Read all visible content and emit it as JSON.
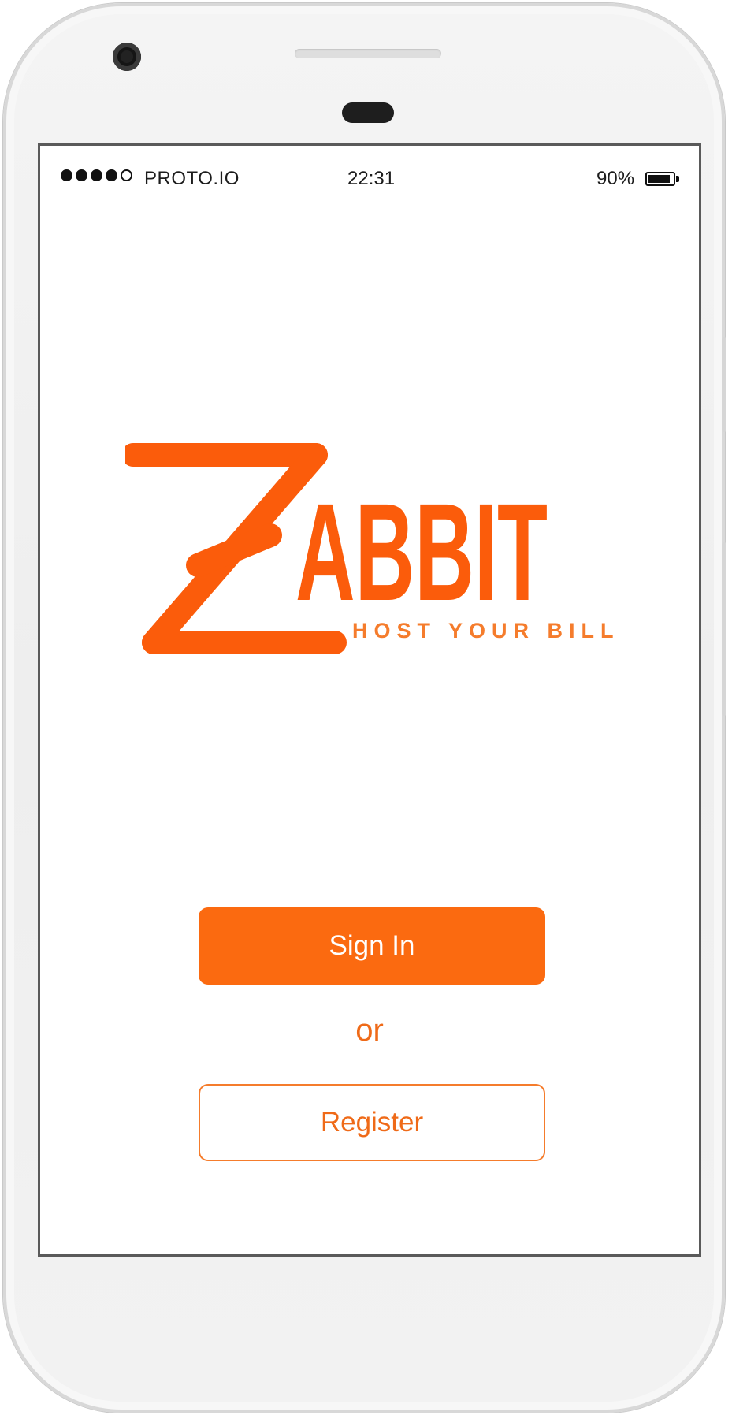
{
  "status_bar": {
    "carrier": "PROTO.IO",
    "time": "22:31",
    "battery": "90%",
    "signal_bars_filled": 4,
    "signal_bars_total": 5,
    "battery_level": 0.9
  },
  "logo": {
    "wordmark": "ZABBIT",
    "tagline": "HOST YOUR BILL",
    "color": "#fb5c0b"
  },
  "auth": {
    "sign_in_label": "Sign In",
    "separator": "or",
    "register_label": "Register"
  },
  "colors": {
    "accent": "#fb6a10",
    "accent_text": "#ef6a18"
  }
}
